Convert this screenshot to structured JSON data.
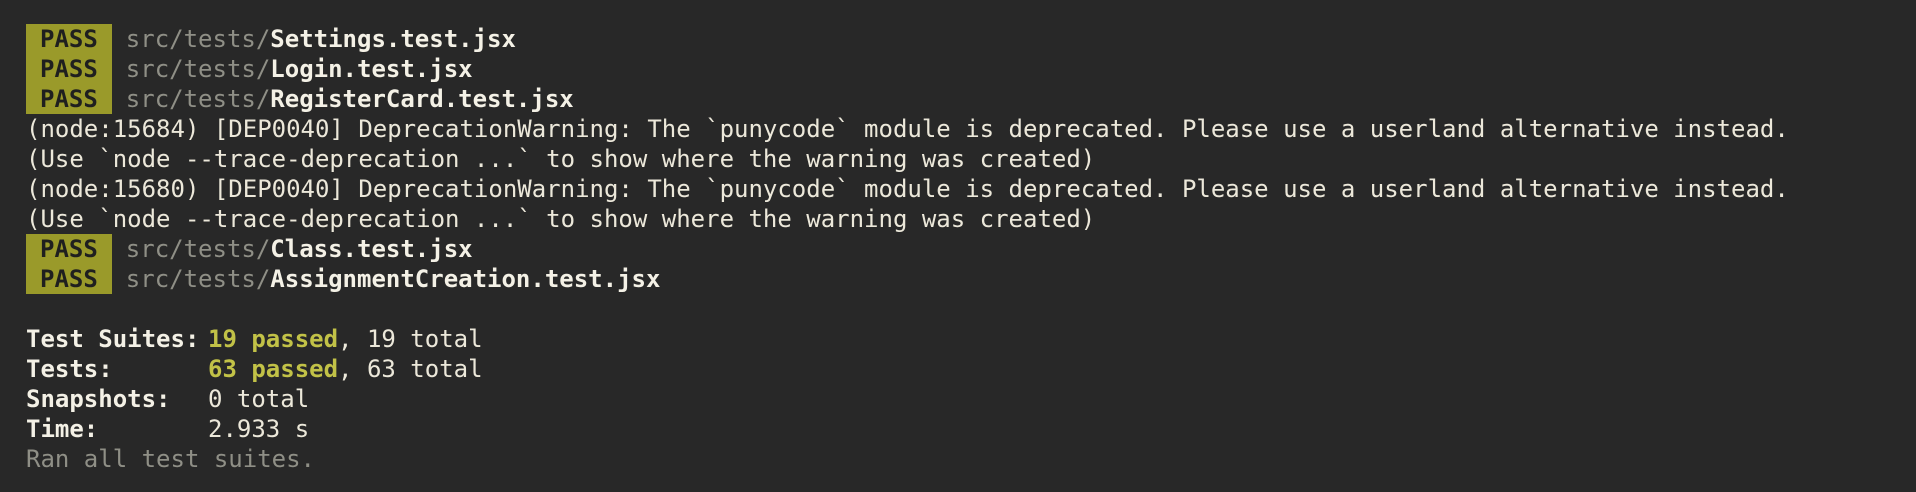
{
  "colors": {
    "background": "#282828",
    "pass_badge_bg": "#9a9a2a",
    "passed_text": "#c2c247",
    "dim_text": "#8f8f86",
    "default_text": "#ece8da"
  },
  "results_before": [
    {
      "status": "PASS",
      "dir": "src/tests/",
      "file": "Settings.test.jsx"
    },
    {
      "status": "PASS",
      "dir": "src/tests/",
      "file": "Login.test.jsx"
    },
    {
      "status": "PASS",
      "dir": "src/tests/",
      "file": "RegisterCard.test.jsx"
    }
  ],
  "warnings": [
    "(node:15684) [DEP0040] DeprecationWarning: The `punycode` module is deprecated. Please use a userland alternative instead.",
    "(Use `node --trace-deprecation ...` to show where the warning was created)",
    "(node:15680) [DEP0040] DeprecationWarning: The `punycode` module is deprecated. Please use a userland alternative instead.",
    "(Use `node --trace-deprecation ...` to show where the warning was created)"
  ],
  "results_after": [
    {
      "status": "PASS",
      "dir": "src/tests/",
      "file": "Class.test.jsx"
    },
    {
      "status": "PASS",
      "dir": "src/tests/",
      "file": "AssignmentCreation.test.jsx"
    }
  ],
  "summary": {
    "suites_label": "Test Suites:",
    "suites_passed": "19 passed",
    "suites_total": ", 19 total",
    "tests_label": "Tests:",
    "tests_passed": "63 passed",
    "tests_total": ", 63 total",
    "snapshots_label": "Snapshots:",
    "snapshots_value": "0 total",
    "time_label": "Time:",
    "time_value": "2.933 s",
    "footer": "Ran all test suites."
  }
}
